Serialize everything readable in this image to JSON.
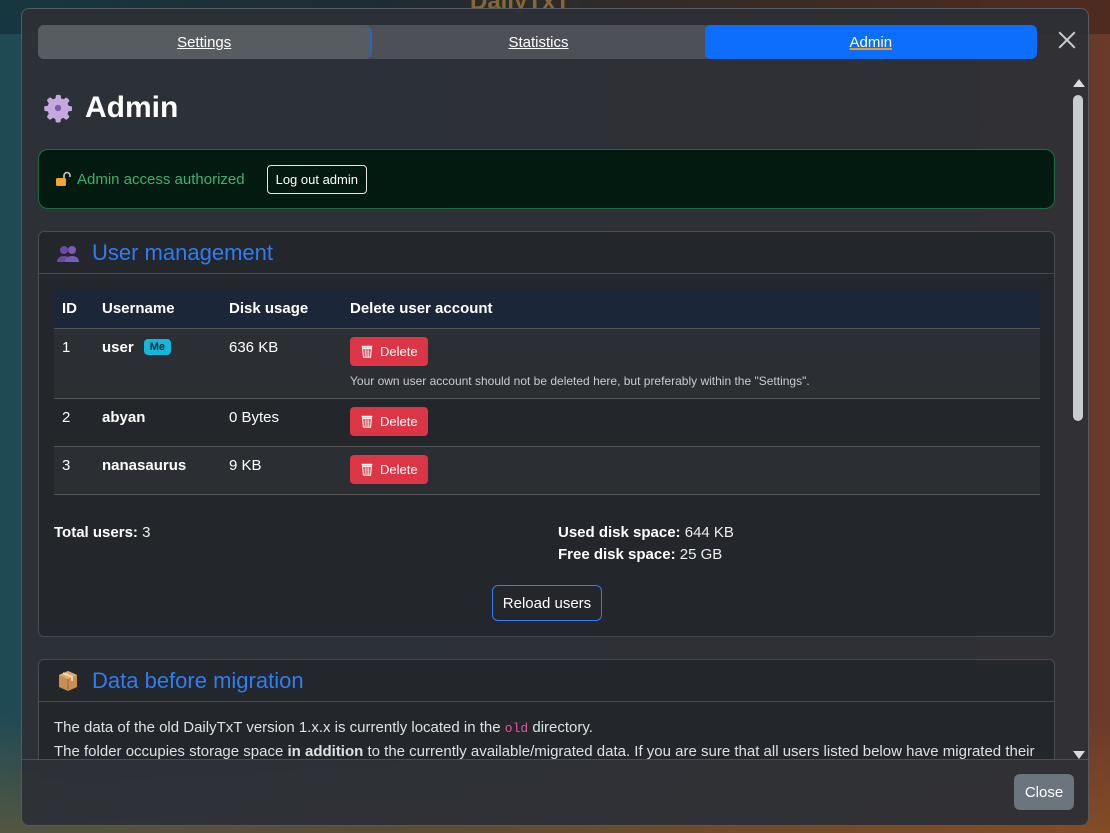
{
  "background": {
    "app_title": "DailyTxT"
  },
  "tabs": [
    {
      "label": "Settings"
    },
    {
      "label": "Statistics"
    },
    {
      "label": "Admin"
    }
  ],
  "page": {
    "title": "Admin"
  },
  "auth_alert": {
    "text": "Admin access authorized",
    "logout_label": "Log out admin"
  },
  "user_management": {
    "title": "User management",
    "columns": [
      "ID",
      "Username",
      "Disk usage",
      "Delete user account"
    ],
    "rows": [
      {
        "id": "1",
        "username": "user",
        "badge": "Me",
        "disk": "636 KB",
        "delete_label": "Delete",
        "hint": "Your own user account should not be deleted here, but preferably within the \"Settings\"."
      },
      {
        "id": "2",
        "username": "abyan",
        "disk": "0 Bytes",
        "delete_label": "Delete"
      },
      {
        "id": "3",
        "username": "nanasaurus",
        "disk": "9 KB",
        "delete_label": "Delete"
      }
    ],
    "total_users_label": "Total users:",
    "total_users_value": "3",
    "used_label": "Used disk space:",
    "used_value": "644 KB",
    "free_label": "Free disk space:",
    "free_value": "25 GB",
    "reload_label": "Reload users"
  },
  "migration": {
    "title": "Data before migration",
    "line1_pre": "The data of the old DailyTxT version 1.x.x is currently located in the",
    "line1_code": "old",
    "line1_post": "directory.",
    "line2_pre": "The folder occupies storage space",
    "line2_bold": "in addition",
    "line2_post": "to the currently available/migrated data. If you are sure that all users listed below have migrated their"
  },
  "footer": {
    "close_label": "Close"
  },
  "colors": {
    "primary": "#0d6efd",
    "danger": "#dc3545",
    "success_text": "#39b36d",
    "badge": "#14b8de"
  }
}
